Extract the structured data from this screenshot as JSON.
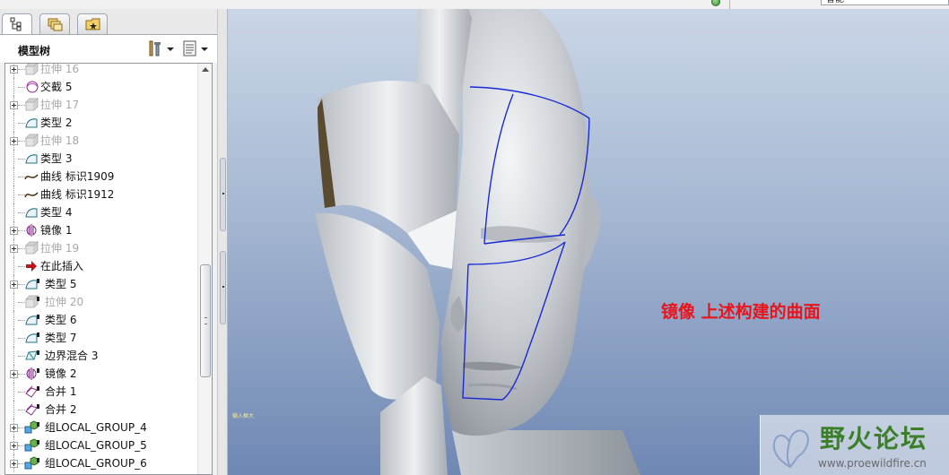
{
  "top": {
    "field_value": "智能"
  },
  "panel": {
    "title": "模型树"
  },
  "tree": {
    "items": [
      {
        "label": "拉伸 16",
        "icon": "extrude-icon",
        "disabled": true,
        "expandable": true
      },
      {
        "label": "交截 5",
        "icon": "intersect-icon",
        "disabled": false,
        "expandable": false
      },
      {
        "label": "拉伸 17",
        "icon": "extrude-icon",
        "disabled": true,
        "expandable": true
      },
      {
        "label": "类型 2",
        "icon": "surface-icon",
        "disabled": false,
        "expandable": false
      },
      {
        "label": "拉伸 18",
        "icon": "extrude-icon",
        "disabled": true,
        "expandable": true
      },
      {
        "label": "类型 3",
        "icon": "surface-icon",
        "disabled": false,
        "expandable": false
      },
      {
        "label": "曲线 标识1909",
        "icon": "curve-icon",
        "disabled": false,
        "expandable": false
      },
      {
        "label": "曲线 标识1912",
        "icon": "curve-icon",
        "disabled": false,
        "expandable": false
      },
      {
        "label": "类型 4",
        "icon": "surface-icon",
        "disabled": false,
        "expandable": false
      },
      {
        "label": "镜像 1",
        "icon": "mirror-icon",
        "disabled": false,
        "expandable": true
      },
      {
        "label": "拉伸 19",
        "icon": "extrude-icon",
        "disabled": true,
        "expandable": true
      },
      {
        "label": "在此插入",
        "icon": "insert-here-icon",
        "disabled": false,
        "expandable": false
      },
      {
        "label": "类型 5",
        "icon": "surface-icon",
        "disabled": false,
        "expandable": true,
        "pinned": true
      },
      {
        "label": "拉伸 20",
        "icon": "extrude-icon",
        "disabled": true,
        "expandable": false,
        "pinned": true
      },
      {
        "label": "类型 6",
        "icon": "surface-icon",
        "disabled": false,
        "expandable": false,
        "pinned": true
      },
      {
        "label": "类型 7",
        "icon": "surface-icon",
        "disabled": false,
        "expandable": false,
        "pinned": true
      },
      {
        "label": "边界混合 3",
        "icon": "boundary-blend-icon",
        "disabled": false,
        "expandable": false,
        "pinned": true
      },
      {
        "label": "镜像 2",
        "icon": "mirror-icon",
        "disabled": false,
        "expandable": true,
        "pinned": true
      },
      {
        "label": "合并 1",
        "icon": "merge-icon",
        "disabled": false,
        "expandable": false,
        "pinned": true
      },
      {
        "label": "合并 2",
        "icon": "merge-icon",
        "disabled": false,
        "expandable": false,
        "pinned": true
      },
      {
        "label": "组LOCAL_GROUP_4",
        "icon": "group-icon",
        "disabled": false,
        "expandable": true,
        "pinned": true
      },
      {
        "label": "组LOCAL_GROUP_5",
        "icon": "group-icon",
        "disabled": false,
        "expandable": true,
        "pinned": true
      },
      {
        "label": "组LOCAL_GROUP_6",
        "icon": "group-icon",
        "disabled": false,
        "expandable": true,
        "pinned": true
      }
    ]
  },
  "viewport": {
    "annotation": "镜像 上述构建的曲面",
    "tiny_label": "输入框大",
    "annotation_color": "#e8141b"
  },
  "watermark": {
    "title": "野火论坛",
    "url": "www.proewildfire.cn"
  }
}
